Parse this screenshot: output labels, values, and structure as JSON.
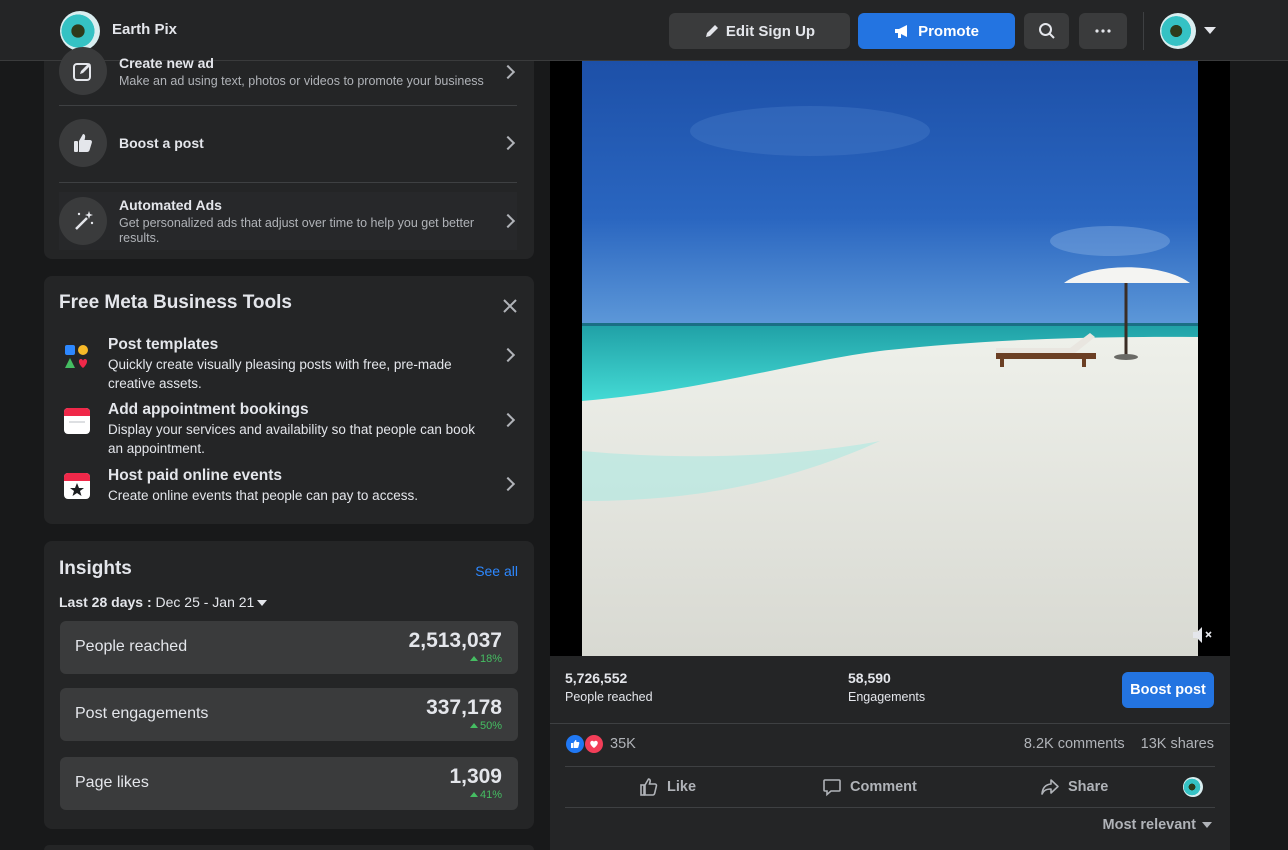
{
  "header": {
    "page_name": "Earth Pix",
    "edit_label": "Edit Sign Up",
    "promote_label": "Promote"
  },
  "ads": {
    "create_title": "Create new ad",
    "create_desc": "Make an ad using text, photos or videos to promote your business",
    "boost_title": "Boost a post",
    "auto_title": "Automated Ads",
    "auto_desc": "Get personalized ads that adjust over time to help you get better results."
  },
  "tools": {
    "title": "Free Meta Business Tools",
    "items": [
      {
        "title": "Post templates",
        "desc": "Quickly create visually pleasing posts with free, pre-made creative assets."
      },
      {
        "title": "Add appointment bookings",
        "desc": "Display your services and availability so that people can book an appointment."
      },
      {
        "title": "Host paid online events",
        "desc": "Create online events that people can pay to access."
      }
    ]
  },
  "insights": {
    "title": "Insights",
    "see_all": "See all",
    "range_label": "Last 28 days :",
    "range_value": "Dec 25 - Jan 21",
    "metrics": [
      {
        "label": "People reached",
        "value": "2,513,037",
        "change": "18%"
      },
      {
        "label": "Post engagements",
        "value": "337,178",
        "change": "50%"
      },
      {
        "label": "Page likes",
        "value": "1,309",
        "change": "41%"
      }
    ]
  },
  "post": {
    "reach_value": "5,726,552",
    "reach_label": "People reached",
    "eng_value": "58,590",
    "eng_label": "Engagements",
    "boost_label": "Boost post",
    "reaction_count": "35K",
    "comments": "8.2K comments",
    "shares": "13K shares",
    "like_label": "Like",
    "comment_label": "Comment",
    "share_label": "Share",
    "sort_label": "Most relevant"
  },
  "colors": {
    "background": "#18191a",
    "surface": "#242526",
    "accent": "#2374e1",
    "positive": "#45bd62"
  }
}
